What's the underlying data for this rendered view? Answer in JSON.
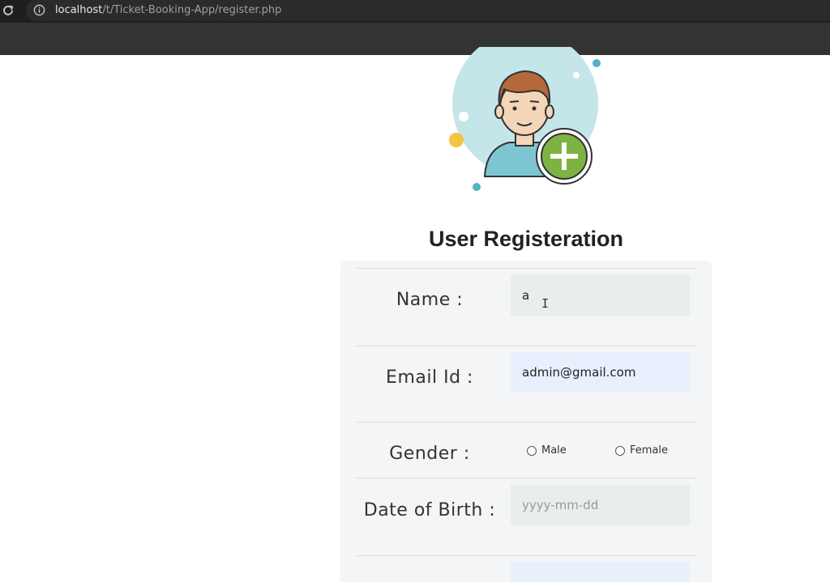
{
  "browser": {
    "url_host": "localhost",
    "url_path": "/t/Ticket-Booking-App/register.php"
  },
  "page": {
    "title": "User Registeration"
  },
  "form": {
    "name_label": "Name :",
    "name_value": "a",
    "email_label": "Email Id :",
    "email_value": "admin@gmail.com",
    "gender_label": "Gender :",
    "gender_options": [
      "Male",
      "Female"
    ],
    "dob_label": "Date of Birth :",
    "dob_placeholder": "yyyy-mm-dd"
  },
  "colors": {
    "avatar_bg": "#c4e6e8",
    "add_badge": "#7cb342",
    "autofill_bg": "#e8f0fe"
  },
  "icons": [
    "reload-icon",
    "info-icon",
    "avatar-icon",
    "add-user-icon",
    "text-cursor-icon"
  ]
}
